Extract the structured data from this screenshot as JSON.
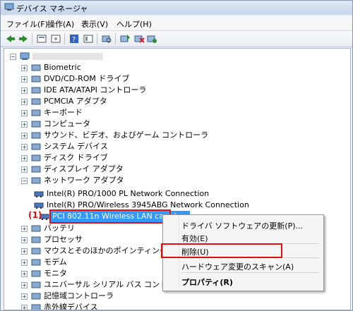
{
  "window": {
    "title": "デバイス マネージャ"
  },
  "menu": [
    "ファイル(F)",
    "操作(A)",
    "表示(V)",
    "ヘルプ(H)"
  ],
  "toolbar": {
    "buttons": [
      "back-icon",
      "forward-icon",
      "properties-icon",
      "show-hidden-icon",
      "help-icon",
      "view-icon",
      "scan-icon",
      "update-driver-icon",
      "uninstall-icon",
      "enable-icon"
    ]
  },
  "tree": {
    "computer_name": "",
    "categories": [
      "Biometric",
      "DVD/CD-ROM ドライブ",
      "IDE ATA/ATAPI コントローラ",
      "PCMCIA アダプタ",
      "キーボード",
      "コンピュータ",
      "サウンド、ビデオ、およびゲーム コントローラ",
      "システム デバイス",
      "ディスク ドライブ",
      "ディスプレイ アダプタ",
      "ネットワーク アダプタ"
    ],
    "network_children": [
      "Intel(R) PRO/1000 PL Network Connection",
      "Intel(R) PRO/Wireless 3945ABG Network Connection",
      "PCI 802.11n Wireless LAN card bus"
    ],
    "after_categories": [
      "バッテリ",
      "プロセッサ",
      "マウスとそのほかのポインティング デ",
      "モデム",
      "モニタ",
      "ユニバーサル シリアル バス コントロ",
      "記憶域コントローラ",
      "赤外線デバイス"
    ]
  },
  "annotation": {
    "marker": "(1)"
  },
  "context_menu": {
    "items": [
      "ドライバ ソフトウェアの更新(P)...",
      "有効(E)",
      "削除(U)",
      "ハードウェア変更のスキャン(A)",
      "プロパティ(R)"
    ],
    "highlight_color": "#e01010"
  }
}
